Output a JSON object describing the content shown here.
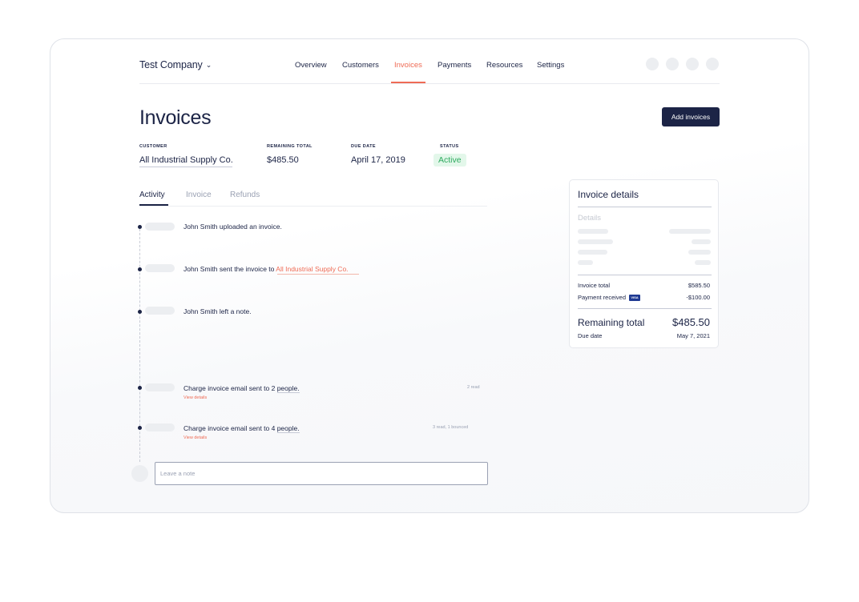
{
  "header": {
    "company": "Test Company",
    "nav": [
      {
        "label": "Overview"
      },
      {
        "label": "Customers"
      },
      {
        "label": "Invoices"
      },
      {
        "label": "Payments"
      },
      {
        "label": "Resources"
      },
      {
        "label": "Settings"
      }
    ],
    "active_nav": "Invoices"
  },
  "page": {
    "title": "Invoices",
    "add_button": "Add invoices"
  },
  "meta": {
    "customer_label": "CUSTOMER",
    "customer": "All Industrial Supply Co.",
    "remaining_label": "REMAINING TOTAL",
    "remaining": "$485.50",
    "due_label": "DUE DATE",
    "due": "April 17, 2019",
    "status_label": "STATUS",
    "status": "Active"
  },
  "tabs": [
    {
      "label": "Activity"
    },
    {
      "label": "Invoice"
    },
    {
      "label": "Refunds"
    }
  ],
  "activity": {
    "item1": "John Smith uploaded an invoice.",
    "item2_prefix": "John Smith sent the invoice to ",
    "item2_link": "All Industrial Supply Co.",
    "item3": "John Smith left a note.",
    "item4_prefix": "Charge invoice email sent to 2 ",
    "item4_link": "people.",
    "item4_sub": "View details",
    "item4_right": "2 read",
    "item5_prefix": "Charge invoice email sent to 4 ",
    "item5_link": "people.",
    "item5_sub": "View details",
    "item5_right": "3 read, 1 bounced"
  },
  "note": {
    "placeholder": "Leave a note"
  },
  "details": {
    "title": "Invoice details",
    "subtitle": "Details",
    "invoice_total_label": "Invoice total",
    "invoice_total": "$585.50",
    "payment_label": "Payment received",
    "payment_card": "VISA",
    "payment": "-$100.00",
    "remaining_label": "Remaining total",
    "remaining": "$485.50",
    "due_label": "Due date",
    "due": "May 7, 2021"
  },
  "colors": {
    "accent": "#ef6b55",
    "navy": "#1c2446",
    "status_green": "#2eaa5f"
  }
}
